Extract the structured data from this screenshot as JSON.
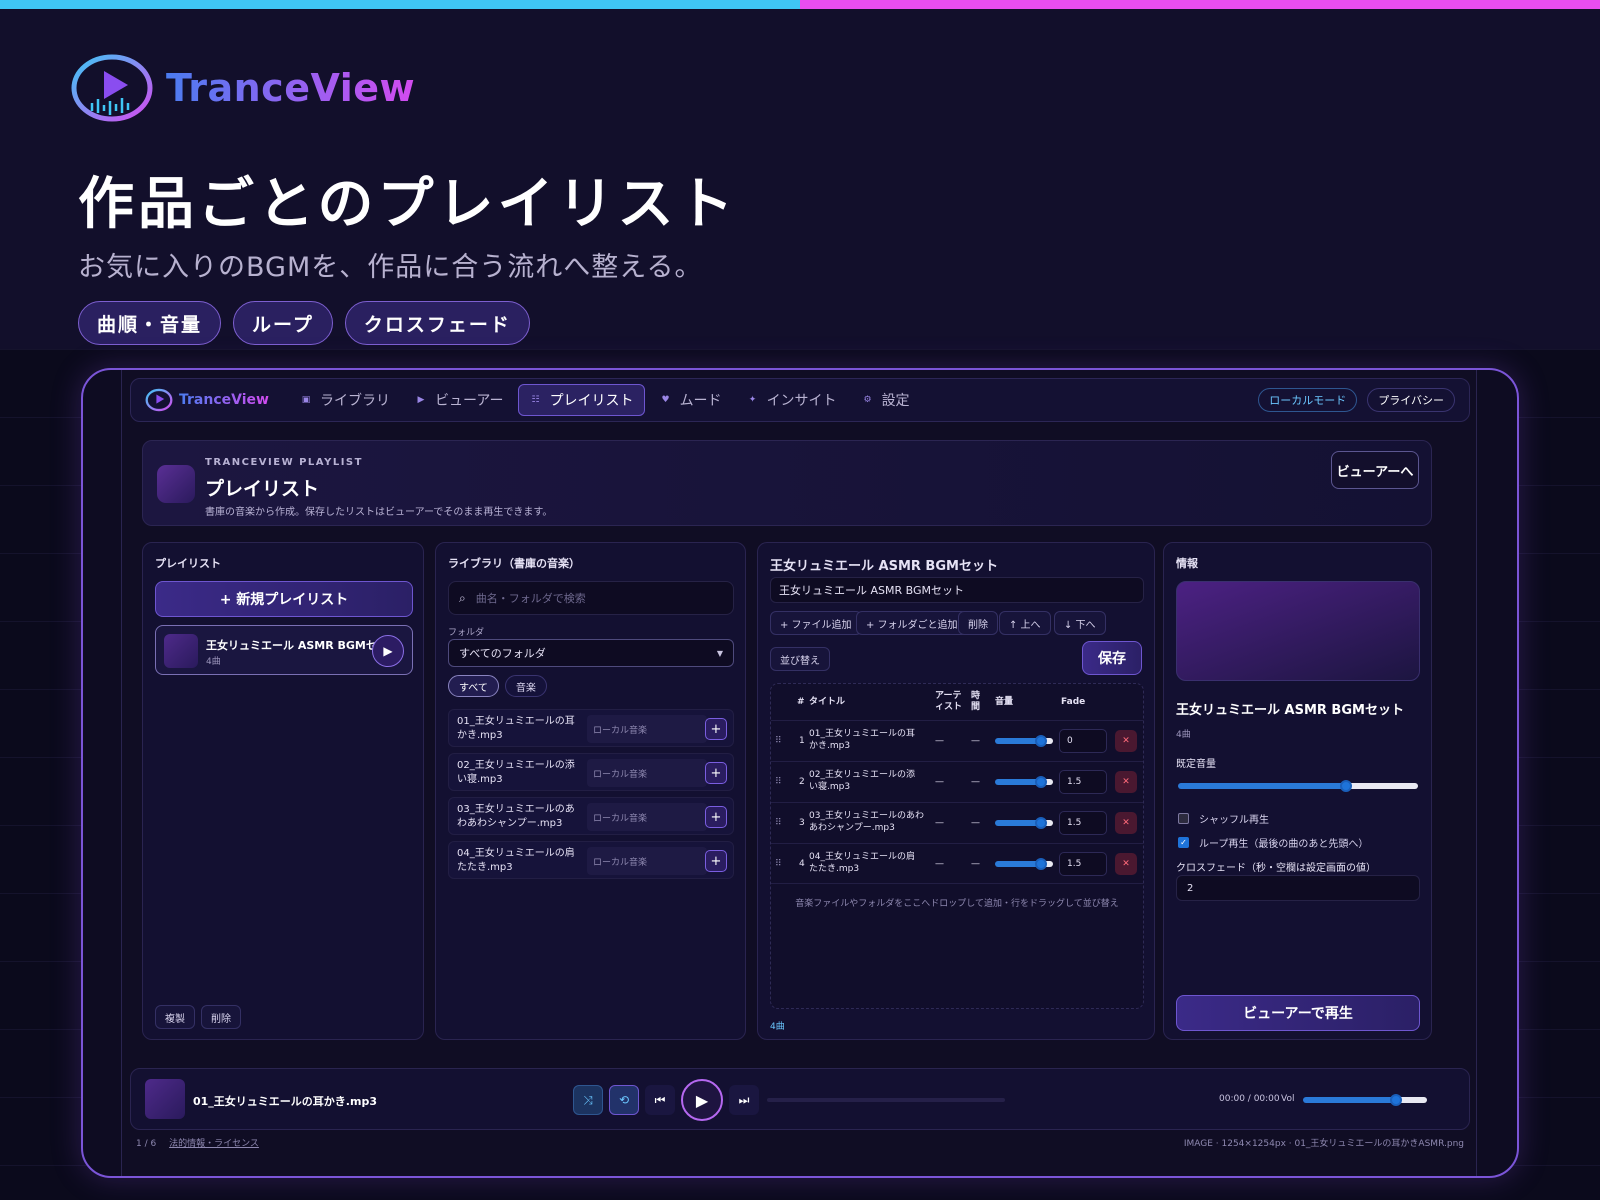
{
  "hero": {
    "brand": "TranceView",
    "title": "作品ごとのプレイリスト",
    "subtitle": "お気に入りのBGMを、作品に合う流れへ整える。",
    "pills": [
      "曲順・音量",
      "ループ",
      "クロスフェード"
    ]
  },
  "nav": {
    "brand": "TranceView",
    "items": [
      {
        "label": "ライブラリ",
        "icon": "library-icon"
      },
      {
        "label": "ビューアー",
        "icon": "play-icon"
      },
      {
        "label": "プレイリスト",
        "icon": "list-icon",
        "active": true
      },
      {
        "label": "ムード",
        "icon": "heart-icon"
      },
      {
        "label": "インサイト",
        "icon": "sparkle-icon"
      },
      {
        "label": "設定",
        "icon": "gear-icon"
      }
    ],
    "local_mode": "ローカルモード",
    "privacy": "プライバシー"
  },
  "header": {
    "kicker": "TRANCEVIEW PLAYLIST",
    "title": "プレイリスト",
    "desc": "書庫の音楽から作成。保存したリストはビューアーでそのまま再生できます。",
    "to_viewer": "ビューアーへ"
  },
  "playlists": {
    "title": "プレイリスト",
    "new_button": "+ 新規プレイリスト",
    "items": [
      {
        "name": "王女リュミエール ASMR BGMセット",
        "count": "4曲"
      }
    ],
    "duplicate": "複製",
    "delete": "削除"
  },
  "library": {
    "title": "ライブラリ（書庫の音楽）",
    "search_placeholder": "曲名・フォルダで検索",
    "folder_label": "フォルダ",
    "folder_value": "すべてのフォルダ",
    "filters": [
      "すべて",
      "音楽"
    ],
    "tracks": [
      {
        "name": "01_王女リュミエールの耳かき.mp3",
        "tag": "ローカル音楽"
      },
      {
        "name": "02_王女リュミエールの添い寝.mp3",
        "tag": "ローカル音楽"
      },
      {
        "name": "03_王女リュミエールのあわあわシャンプー.mp3",
        "tag": "ローカル音楽"
      },
      {
        "name": "04_王女リュミエールの肩たたき.mp3",
        "tag": "ローカル音楽"
      }
    ]
  },
  "editor": {
    "title": "王女リュミエール ASMR BGMセット",
    "name_value": "王女リュミエール ASMR BGMセット",
    "toolbar": {
      "add_file": "+ ファイル追加",
      "add_folder": "+ フォルダごと追加",
      "delete": "削除",
      "up": "↑ 上へ",
      "down": "↓ 下へ",
      "sort": "並び替え"
    },
    "save": "保存",
    "columns": {
      "num": "#",
      "title": "タイトル",
      "artist": "アーティスト",
      "time": "時間",
      "volume": "音量",
      "fade": "Fade"
    },
    "rows": [
      {
        "num": "1",
        "title": "01_王女リュミエールの耳かき.mp3",
        "artist": "—",
        "time": "—",
        "volume": 0.8,
        "fade": "0"
      },
      {
        "num": "2",
        "title": "02_王女リュミエールの添い寝.mp3",
        "artist": "—",
        "time": "—",
        "volume": 0.8,
        "fade": "1.5"
      },
      {
        "num": "3",
        "title": "03_王女リュミエールのあわあわシャンプー.mp3",
        "artist": "—",
        "time": "—",
        "volume": 0.8,
        "fade": "1.5"
      },
      {
        "num": "4",
        "title": "04_王女リュミエールの肩たたき.mp3",
        "artist": "—",
        "time": "—",
        "volume": 0.8,
        "fade": "1.5"
      }
    ],
    "drop_hint": "音楽ファイルやフォルダをここへドロップして追加・行をドラッグして並び替え",
    "count": "4曲"
  },
  "info": {
    "title": "情報",
    "name": "王女リュミエール ASMR BGMセット",
    "count": "4曲",
    "default_volume_label": "既定音量",
    "default_volume": 0.7,
    "shuffle": "シャッフル再生",
    "loop": "ループ再生（最後の曲のあと先頭へ）",
    "crossfade_label": "クロスフェード（秒・空欄は設定画面の値）",
    "crossfade_value": "2",
    "play": "ビューアーで再生"
  },
  "player": {
    "track": "01_王女リュミエールの耳かき.mp3",
    "time": "00:00 / 00:00",
    "vol_label": "Vol",
    "volume": 0.75,
    "progress": 0
  },
  "footer": {
    "page": "1 / 6",
    "legal": "法的情報・ライセンス",
    "image_info": "IMAGE · 1254×1254px · 01_王女リュミエールの耳かきASMR.png"
  },
  "colors": {
    "accent": "#6e56d0",
    "blue": "#1e73d9",
    "bg": "#0c0a1e"
  }
}
